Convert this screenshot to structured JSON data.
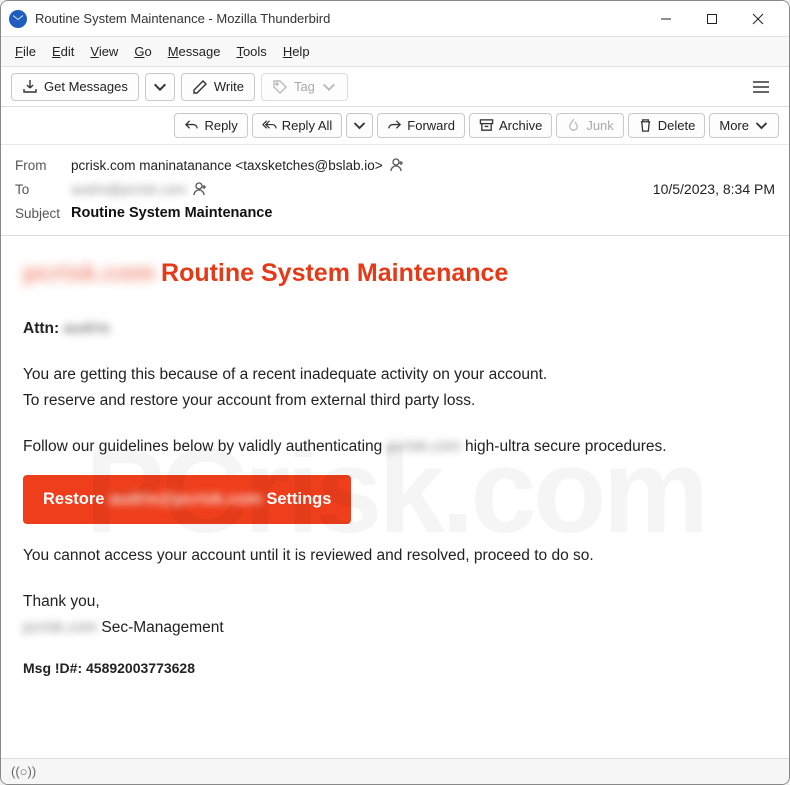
{
  "window": {
    "title": "Routine System Maintenance - Mozilla Thunderbird"
  },
  "menubar": {
    "file": "File",
    "edit": "Edit",
    "view": "View",
    "go": "Go",
    "message": "Message",
    "tools": "Tools",
    "help": "Help"
  },
  "toolbar": {
    "get_messages": "Get Messages",
    "write": "Write",
    "tag": "Tag"
  },
  "actions": {
    "reply": "Reply",
    "reply_all": "Reply All",
    "forward": "Forward",
    "archive": "Archive",
    "junk": "Junk",
    "delete": "Delete",
    "more": "More"
  },
  "headers": {
    "from_label": "From",
    "from_value": "pcrisk.com maninatanance <taxsketches@bslab.io>",
    "to_label": "To",
    "to_value_blurred": "audris@pcrisk.com",
    "subject_label": "Subject",
    "subject_value": "Routine System Maintenance",
    "datetime": "10/5/2023, 8:34 PM"
  },
  "body": {
    "title_prefix_blurred": "pcrisk.com",
    "title": "Routine System Maintenance",
    "attn_label": "Attn:",
    "attn_name_blurred": "audris",
    "p1": "You are getting this because of a recent inadequate activity on your account.",
    "p2": "To reserve and restore your account from external third party loss.",
    "p3_a": "Follow our guidelines below by validly authenticating ",
    "p3_blur": "pcrisk.com",
    "p3_b": " high-ultra secure procedures.",
    "restore_a": "Restore ",
    "restore_blur": "audris@pcrisk.com",
    "restore_b": " Settings",
    "p4": "You cannot access your account until it is reviewed and resolved, proceed to do so.",
    "thank": "Thank you,",
    "sig_blur": "pcrisk.com",
    "sig_rest": " Sec-Management",
    "msg_id": "Msg !D#: 45892003773628"
  },
  "watermark": "PCrisk.com"
}
